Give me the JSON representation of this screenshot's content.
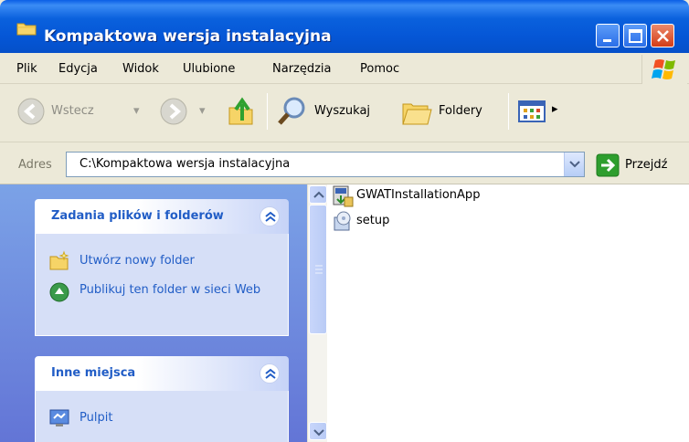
{
  "window": {
    "title": "Kompaktowa wersja instalacyjna"
  },
  "menu": {
    "items": [
      "Plik",
      "Edycja",
      "Widok",
      "Ulubione",
      "Narzędzia",
      "Pomoc"
    ]
  },
  "toolbar": {
    "back_label": "Wstecz",
    "search_label": "Wyszukaj",
    "folders_label": "Foldery"
  },
  "address": {
    "label": "Adres",
    "value": "C:\\Kompaktowa wersja instalacyjna",
    "go_label": "Przejdź"
  },
  "taskpane": {
    "file_tasks": {
      "title": "Zadania plików i folderów",
      "items": [
        "Utwórz nowy folder",
        "Publikuj ten folder w sieci Web"
      ]
    },
    "other_places": {
      "title": "Inne miejsca",
      "items": [
        "Pulpit"
      ]
    }
  },
  "files": [
    {
      "name": "GWATInstallationApp",
      "icon": "installer-app-icon"
    },
    {
      "name": "setup",
      "icon": "setup-icon"
    }
  ],
  "colors": {
    "title_bar": "#0a61dd",
    "task_link": "#215dc6",
    "close_button": "#d33c16"
  }
}
